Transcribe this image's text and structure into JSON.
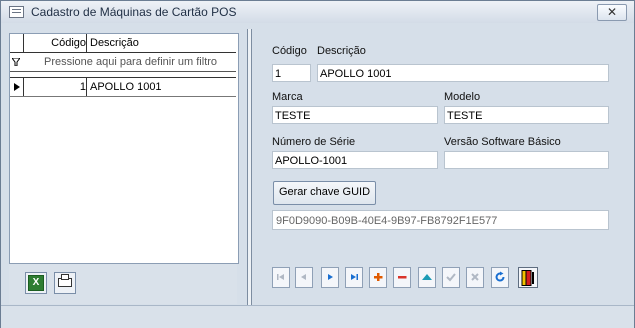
{
  "window": {
    "title": "Cadastro de Máquinas de Cartão POS",
    "close_symbol": "✕"
  },
  "grid": {
    "headers": {
      "code": "Código",
      "description": "Descrição"
    },
    "filter_hint": "Pressione aqui para definir um filtro",
    "rows": [
      {
        "code": "1",
        "description": "APOLLO 1001"
      }
    ]
  },
  "left_toolbar": {
    "excel_icon": "excel-export-icon",
    "print_icon": "printer-icon",
    "excel_glyph": "X"
  },
  "form": {
    "codigo_label": "Código",
    "codigo_value": "1",
    "descricao_label": "Descrição",
    "descricao_value": "APOLLO 1001",
    "marca_label": "Marca",
    "marca_value": "TESTE",
    "modelo_label": "Modelo",
    "modelo_value": "TESTE",
    "numero_serie_label": "Número de Série",
    "numero_serie_value": "APOLLO-1001",
    "versao_sb_label": "Versão Software Básico",
    "versao_sb_value": "",
    "guid_button": "Gerar chave GUID",
    "guid_value": "9F0D9090-B09B-40E4-9B97-FB8792F1E577"
  },
  "navigator": {
    "buttons": [
      "first-icon",
      "prior-icon",
      "next-icon",
      "last-icon",
      "insert-icon",
      "delete-icon",
      "edit-icon",
      "post-icon",
      "cancel-icon",
      "refresh-icon"
    ],
    "exit_icon": "exit-door-icon"
  },
  "colors": {
    "accent_blue": "#1a6fd1",
    "insert_orange": "#e05a00",
    "delete_red": "#d9342b",
    "edit_teal": "#1c9bb5"
  }
}
